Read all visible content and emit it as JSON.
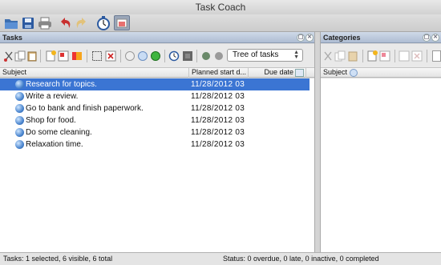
{
  "window": {
    "title": "Task Coach"
  },
  "tasks_panel": {
    "title": "Tasks",
    "view_combo": "Tree of tasks",
    "columns": [
      "Subject",
      "Planned start d...",
      "Due date"
    ],
    "rows": [
      {
        "subject": "Research for topics.",
        "planned": "11/28/2012 03",
        "selected": true
      },
      {
        "subject": "Write a review.",
        "planned": "11/28/2012 03",
        "selected": false
      },
      {
        "subject": "Go to bank and finish paperwork.",
        "planned": "11/28/2012 03",
        "selected": false
      },
      {
        "subject": "Shop for food.",
        "planned": "11/28/2012 03",
        "selected": false
      },
      {
        "subject": "Do some cleaning.",
        "planned": "11/28/2012 03",
        "selected": false
      },
      {
        "subject": "Relaxation time.",
        "planned": "11/28/2012 03",
        "selected": false
      }
    ]
  },
  "categories_panel": {
    "title": "Categories",
    "columns": [
      "Subject"
    ]
  },
  "status": {
    "left": "Tasks: 1 selected, 6 visible, 6 total",
    "right": "Status: 0 overdue, 0 late, 0 inactive, 0 completed"
  },
  "colors": {
    "selection": "#3b75d3",
    "header": "#aebdd3"
  },
  "icons": {
    "main_toolbar": [
      "open-icon",
      "save-icon",
      "print-icon",
      "undo-icon",
      "redo-icon",
      "stopwatch-icon",
      "window-icon"
    ],
    "tasks_toolbar": [
      "cut-icon",
      "copy-icon",
      "paste-icon",
      "new-task-icon",
      "edit-icon",
      "color-icon",
      "select-all-icon",
      "delete-icon",
      "gray-circle-icon",
      "blue-circle-icon",
      "green-circle-icon",
      "clock-icon",
      "stop-icon",
      "green-dot-icon",
      "gray-dot-icon"
    ]
  }
}
